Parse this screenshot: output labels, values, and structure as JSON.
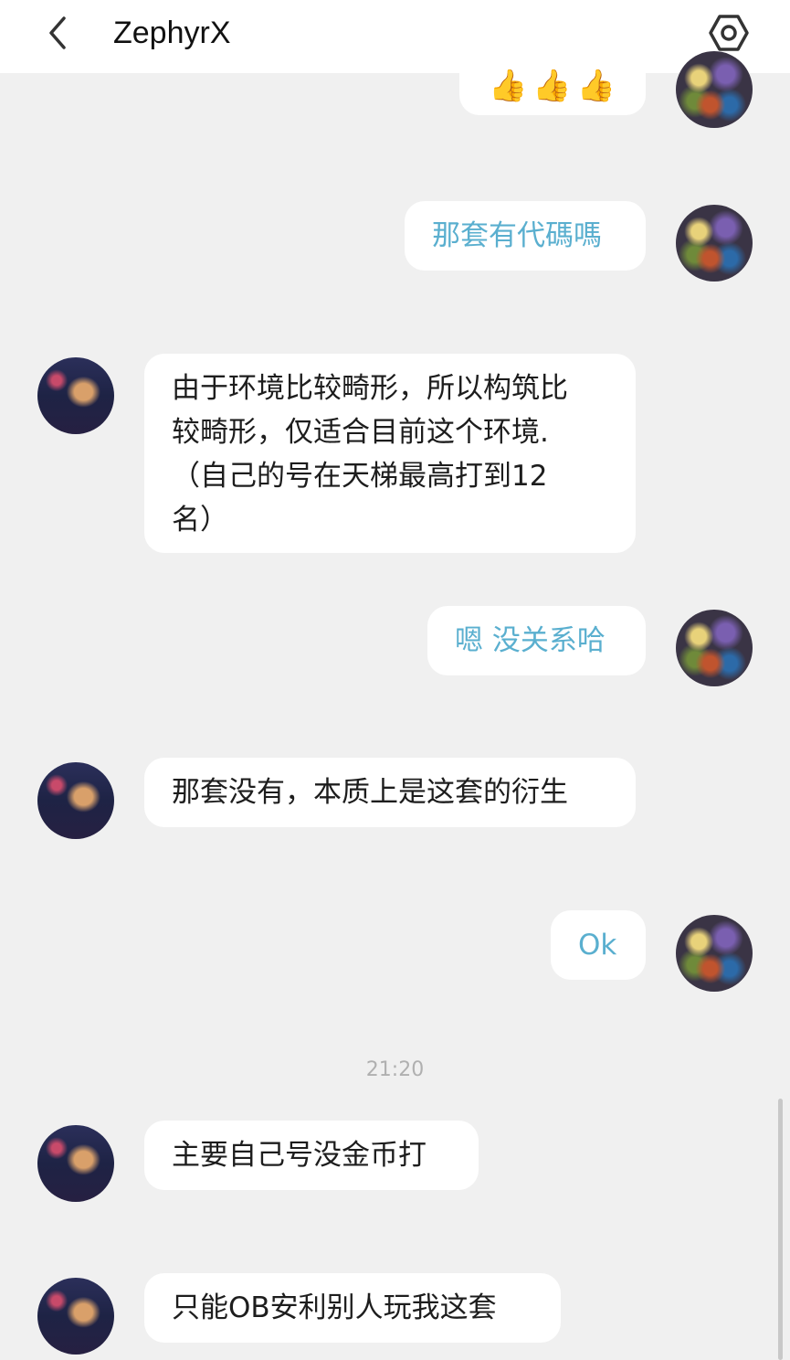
{
  "header": {
    "title": "ZephyrX",
    "back_icon": "chevron-left-icon",
    "settings_icon": "hexagon-gear-icon"
  },
  "colors": {
    "mine_text": "#5aafcf",
    "theirs_text": "#1d1d1d",
    "background": "#f0f0f0",
    "timestamp": "#b0b0b0"
  },
  "messages": [
    {
      "sender": "me",
      "text": "👍👍👍"
    },
    {
      "sender": "me",
      "text": "那套有代碼嗎"
    },
    {
      "sender": "other",
      "text": "由于环境比较畸形，所以构筑比\n较畸形，仅适合目前这个环境.\n（自己的号在天梯最高打到12\n名）"
    },
    {
      "sender": "me",
      "text": "嗯 没关系哈"
    },
    {
      "sender": "other",
      "text": "那套没有，本质上是这套的衍生"
    },
    {
      "sender": "me",
      "text": "Ok"
    },
    {
      "sender": "other",
      "text": "主要自己号没金币打"
    },
    {
      "sender": "other",
      "text": "只能OB安利别人玩我这套"
    }
  ],
  "timestamp": "21:20"
}
